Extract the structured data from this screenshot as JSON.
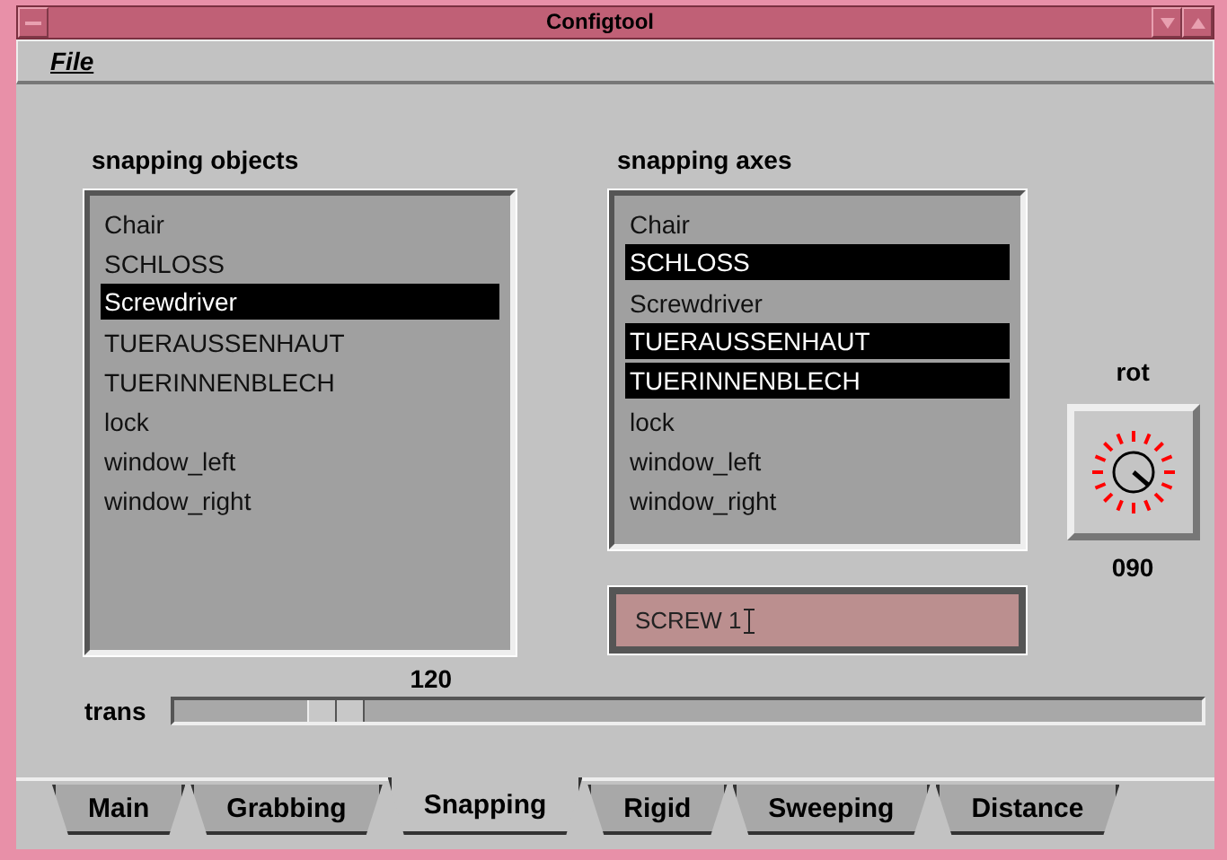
{
  "window": {
    "title": "Configtool"
  },
  "menu": [
    "File"
  ],
  "objects": {
    "heading": "snapping objects",
    "items": [
      {
        "label": "Chair",
        "selected": false
      },
      {
        "label": "SCHLOSS",
        "selected": false
      },
      {
        "label": "Screwdriver",
        "selected": true
      },
      {
        "label": "TUERAUSSENHAUT",
        "selected": false
      },
      {
        "label": "TUERINNENBLECH",
        "selected": false
      },
      {
        "label": "lock",
        "selected": false
      },
      {
        "label": "window_left",
        "selected": false
      },
      {
        "label": "window_right",
        "selected": false
      }
    ]
  },
  "axes": {
    "heading": "snapping axes",
    "items": [
      {
        "label": "Chair",
        "selected": false
      },
      {
        "label": "SCHLOSS",
        "selected": true
      },
      {
        "label": "Screwdriver",
        "selected": false
      },
      {
        "label": "TUERAUSSENHAUT",
        "selected": true
      },
      {
        "label": "TUERINNENBLECH",
        "selected": true
      },
      {
        "label": "lock",
        "selected": false
      },
      {
        "label": "window_left",
        "selected": false
      },
      {
        "label": "window_right",
        "selected": false
      }
    ]
  },
  "name_field": {
    "value": "SCREW 1"
  },
  "rot": {
    "label": "rot",
    "reading": "090"
  },
  "trans": {
    "label": "trans",
    "reading": "120",
    "level": 0.13
  },
  "tabs": [
    {
      "label": "Main",
      "selected": false
    },
    {
      "label": "Grabbing",
      "selected": false
    },
    {
      "label": "Snapping",
      "selected": true
    },
    {
      "label": "Rigid",
      "selected": false
    },
    {
      "label": "Sweeping",
      "selected": false
    },
    {
      "label": "Distance",
      "selected": false
    }
  ]
}
